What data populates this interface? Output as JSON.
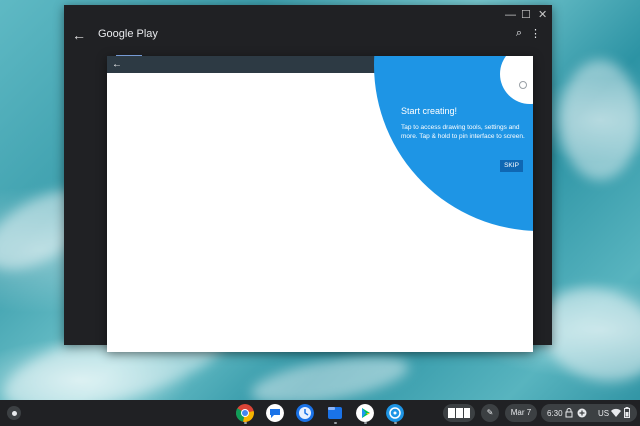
{
  "play_window": {
    "title": "Google Play",
    "back_icon": "←",
    "search_icon": "⌕",
    "more_icon": "⋮",
    "minimize_icon": "—",
    "maximize_icon": "☐",
    "close_icon": "✕"
  },
  "app_window": {
    "back_icon": "←",
    "minimize_icon": "—",
    "maximize_icon": "☐",
    "close_icon": "✕",
    "hint_title": "Start creating!",
    "hint_body": "Tap to access drawing tools, settings and more. Tap & hold to pin interface to screen.",
    "skip_label": "SKIP",
    "accent_color": "#1e95e5"
  },
  "shelf": {
    "apps": [
      {
        "name": "chrome-icon"
      },
      {
        "name": "messages-icon"
      },
      {
        "name": "clock-icon"
      },
      {
        "name": "files-icon"
      },
      {
        "name": "play-store-icon"
      },
      {
        "name": "app-icon"
      }
    ],
    "stylus_icon": "✎",
    "date": "Mar 7",
    "time": "6:30",
    "locale": "US"
  }
}
